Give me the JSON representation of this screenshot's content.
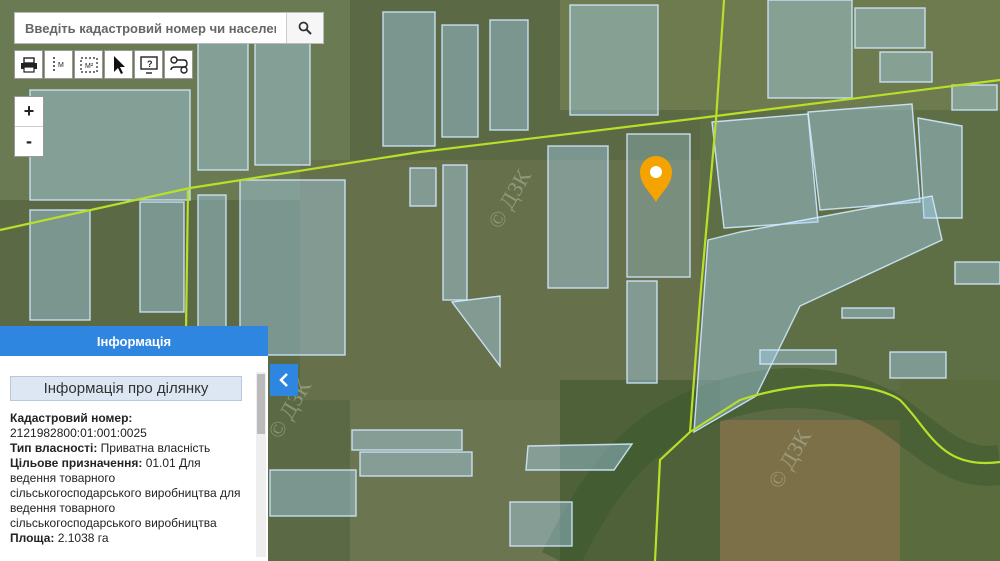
{
  "search": {
    "placeholder": "Введіть кадастровий номер чи населений"
  },
  "toolbar": {
    "tools": [
      "print-icon",
      "measure-line-icon",
      "measure-area-icon",
      "pointer-icon",
      "info-icon",
      "route-icon"
    ]
  },
  "zoom": {
    "in": "+",
    "out": "-"
  },
  "info_panel": {
    "header": "Інформація",
    "subtitle": "Інформація про ділянку",
    "cadastral_label": "Кадастровий номер:",
    "cadastral_value": "2121982800:01:001:0025",
    "ownership_label": "Тип власності:",
    "ownership_value": "Приватна власність",
    "purpose_label": "Цільове призначення:",
    "purpose_value": "01.01 Для ведення товарного сільськогосподарського виробництва для ведення товарного сільськогосподарського виробництва",
    "area_label": "Площа:",
    "area_value": "2.1038 га"
  },
  "colors": {
    "accent": "#2f86e0",
    "marker": "#f5a300",
    "road": "#b8e02a",
    "parcel": "#a9d4f5"
  },
  "collapse_icon": "chevron-left-icon",
  "marker_icon": "location-pin-icon"
}
